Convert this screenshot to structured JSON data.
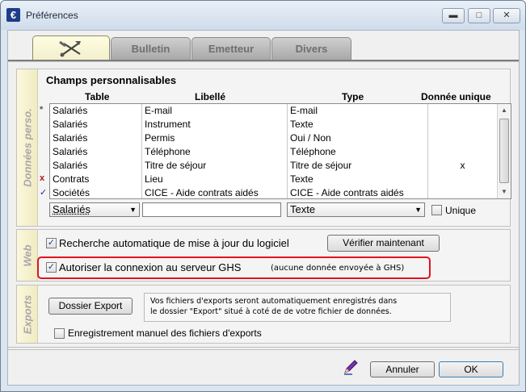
{
  "window": {
    "title": "Préférences",
    "icon": "euro-app-icon",
    "min_glyph": "▬",
    "max_glyph": "□",
    "close_glyph": "✕"
  },
  "tabs": [
    {
      "label": "",
      "icon": "tools-icon",
      "active": true
    },
    {
      "label": "Bulletin"
    },
    {
      "label": "Emetteur"
    },
    {
      "label": "Divers"
    }
  ],
  "donnees": {
    "side_label": "Données perso.",
    "section_title": "Champs personnalisables",
    "columns": [
      "Table",
      "Libellé",
      "Type",
      "Donnée unique"
    ],
    "rows": [
      {
        "marker": "*",
        "table": "Salariés",
        "libelle": "E-mail",
        "type": "E-mail",
        "unique": ""
      },
      {
        "marker": "",
        "table": "Salariés",
        "libelle": "Instrument",
        "type": "Texte",
        "unique": ""
      },
      {
        "marker": "",
        "table": "Salariés",
        "libelle": "Permis",
        "type": "Oui / Non",
        "unique": ""
      },
      {
        "marker": "",
        "table": "Salariés",
        "libelle": "Téléphone",
        "type": "Téléphone",
        "unique": ""
      },
      {
        "marker": "",
        "table": "Salariés",
        "libelle": "Titre de séjour",
        "type": "Titre de séjour",
        "unique": "x"
      },
      {
        "marker": "x",
        "table": "Contrats",
        "libelle": "Lieu",
        "type": "Texte",
        "unique": ""
      },
      {
        "marker": "✓",
        "table": "Sociétés",
        "libelle": "CICE - Aide contrats aidés",
        "type": "CICE - Aide contrats aidés",
        "unique": ""
      }
    ],
    "table_select": "Salariés",
    "libelle_value": "",
    "type_select": "Texte",
    "unique_label": "Unique",
    "unique_checked": false
  },
  "web": {
    "side_label": "Web",
    "auto_update_label": "Recherche automatique de mise à jour du logiciel",
    "auto_update_checked": true,
    "verify_button": "Vérifier maintenant",
    "allow_ghs_label": "Autoriser la connexion au serveur GHS",
    "allow_ghs_checked": true,
    "ghs_note": "(aucune donnée envoyée à GHS)"
  },
  "exports": {
    "side_label": "Exports",
    "folder_button": "Dossier Export",
    "info_line1": "Vos fichiers d'exports seront automatiquement enregistrés dans",
    "info_line2": "le dossier \"Export\" situé à coté de de votre fichier de données.",
    "manual_label": "Enregistrement manuel des fichiers d'exports",
    "manual_checked": false
  },
  "footer": {
    "cancel": "Annuler",
    "ok": "OK",
    "pen_icon": "pen-icon"
  },
  "colors": {
    "highlight": "#e0141c",
    "sidebar_bg": "#f5f1cf",
    "active_tab": "#fbf8d8"
  }
}
